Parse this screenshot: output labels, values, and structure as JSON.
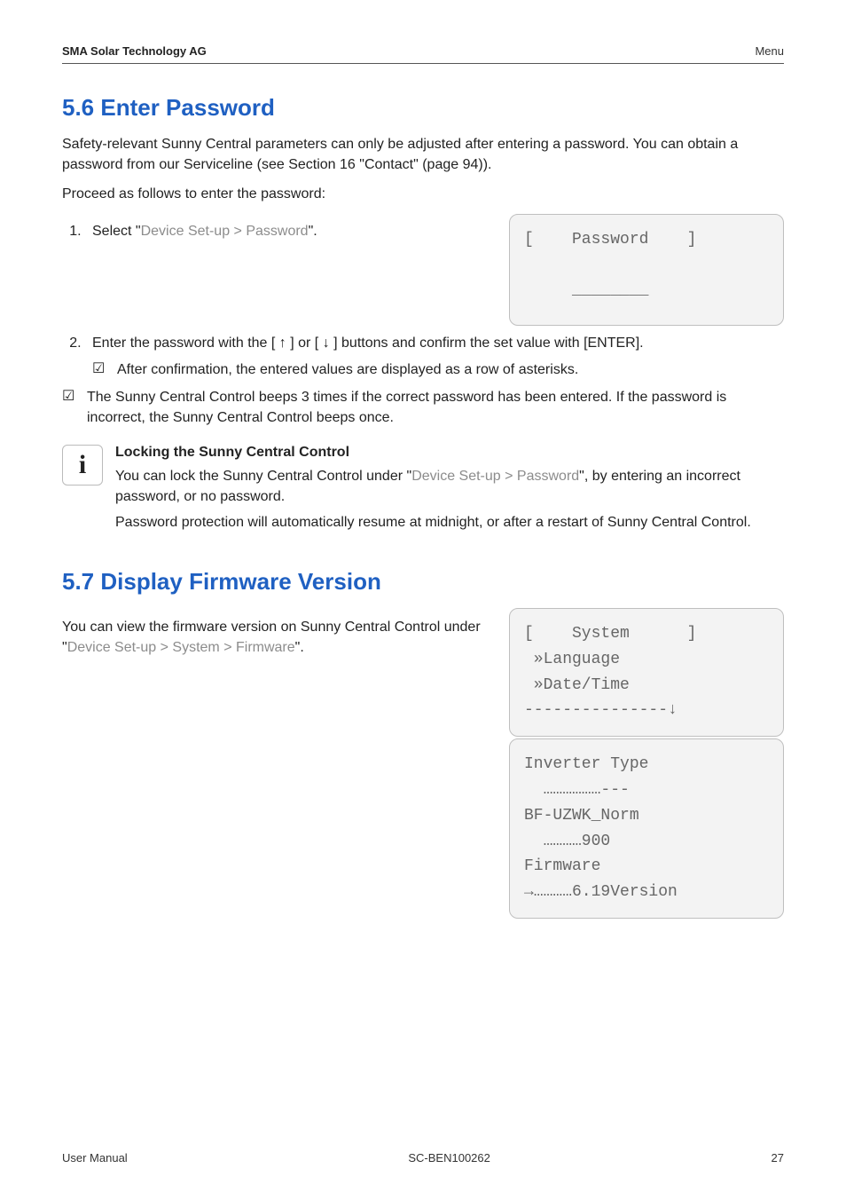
{
  "header": {
    "left": "SMA Solar Technology AG",
    "right": "Menu"
  },
  "section56": {
    "title": "5.6  Enter Password",
    "intro": "Safety-relevant Sunny Central parameters can only be adjusted after entering a password. You can obtain a password from our Serviceline (see Section 16 \"Contact\" (page 94)).",
    "proceed": "Proceed as follows to enter the password:",
    "step1_a": "Select \"",
    "step1_b": "Device Set-up > Password",
    "step1_c": "\".",
    "display1_line1": "[    Password    ]",
    "display1_line2": "     ________",
    "step2_a": "Enter the password with the [ ",
    "step2_up": "↑",
    "step2_b": " ] or [ ",
    "step2_dn": "↓",
    "step2_c": " ] buttons and confirm the set value with [ENTER].",
    "step2_check": "After confirmation, the entered values are displayed as a row of asterisks.",
    "check_main": "The Sunny Central Control beeps 3 times if the correct password has been entered. If the password is incorrect, the Sunny Central Control beeps once.",
    "info_title": "Locking the Sunny Central Control",
    "info_p1_a": "You can lock the Sunny Central Control under \"",
    "info_p1_b": "Device Set-up > Password",
    "info_p1_c": "\", by entering an incorrect password, or no password.",
    "info_p2": "Password protection will automatically resume at midnight, or after a restart of Sunny Central Control."
  },
  "section57": {
    "title": "5.7  Display Firmware Version",
    "p_a": "You can view the firmware version on Sunny Central Control under \"",
    "p_b": "Device Set-up > System > Firmware",
    "p_c": "\".",
    "panel1_line1": "[    System      ]",
    "panel1_line2": " »Language",
    "panel1_line3": " »Date/Time",
    "panel1_line4": "---------------↓",
    "panel2_line1": "Inverter Type",
    "panel2_line2": "  ………………---",
    "panel2_line3": "BF-UZWK_Norm",
    "panel2_line4": "  …………900",
    "panel2_line5": "Firmware",
    "panel2_line6": "→…………6.19Version"
  },
  "footer": {
    "left": "User Manual",
    "center": "SC-BEN100262",
    "right": "27"
  },
  "icons": {
    "check": "☑",
    "info": "i"
  }
}
